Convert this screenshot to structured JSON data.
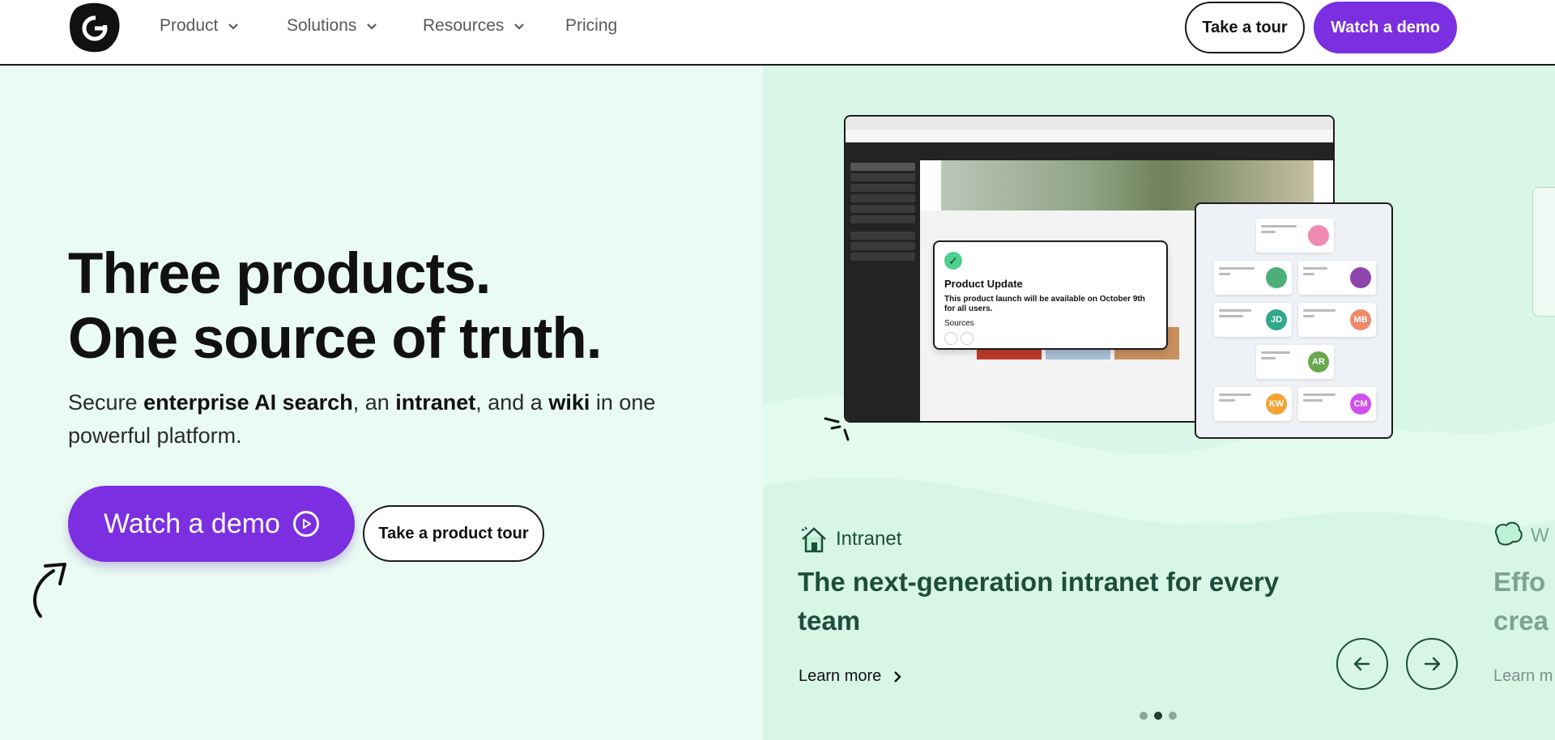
{
  "nav": {
    "items": [
      {
        "label": "Product",
        "has_dropdown": true
      },
      {
        "label": "Solutions",
        "has_dropdown": true
      },
      {
        "label": "Resources",
        "has_dropdown": true
      },
      {
        "label": "Pricing",
        "has_dropdown": false
      }
    ],
    "tour_label": "Take a tour",
    "demo_label": "Watch a demo"
  },
  "hero": {
    "headline_line1": "Three products.",
    "headline_line2": "One source of truth.",
    "sub_part1": "Secure ",
    "sub_bold1": "enterprise AI search",
    "sub_part2": ", an ",
    "sub_bold2": "intranet",
    "sub_part3": ", and a ",
    "sub_bold3": "wiki",
    "sub_part4": " in one powerful platform.",
    "demo_button": "Watch a demo",
    "tour_button": "Take a product tour"
  },
  "mockup": {
    "update_title": "Product Update",
    "update_text": "This product launch will be available on October 9th for all users.",
    "sources_label": "Sources",
    "people": [
      {
        "initials": "JD",
        "color": "#2fa98a"
      },
      {
        "initials": "MB",
        "color": "#f08a6a"
      },
      {
        "initials": "AR",
        "color": "#6aa84f"
      },
      {
        "initials": "KW",
        "color": "#f3a234"
      },
      {
        "initials": "CM",
        "color": "#d24ef0"
      }
    ]
  },
  "carousel": {
    "slide_label": "Intranet",
    "slide_title": "The next-generation intranet for every team",
    "learn_more": "Learn more",
    "next_title_partial": "Effo",
    "next_title_partial_2": "crea",
    "next_learn_partial": "Learn m",
    "next_label_partial": "W",
    "active_dot": 1,
    "dot_count": 3
  },
  "colors": {
    "brand_purple": "#7b2fe0",
    "hero_left_bg": "#eafbf3",
    "hero_right_bg": "#d8f7e8",
    "dark_green": "#1e4d3c"
  }
}
